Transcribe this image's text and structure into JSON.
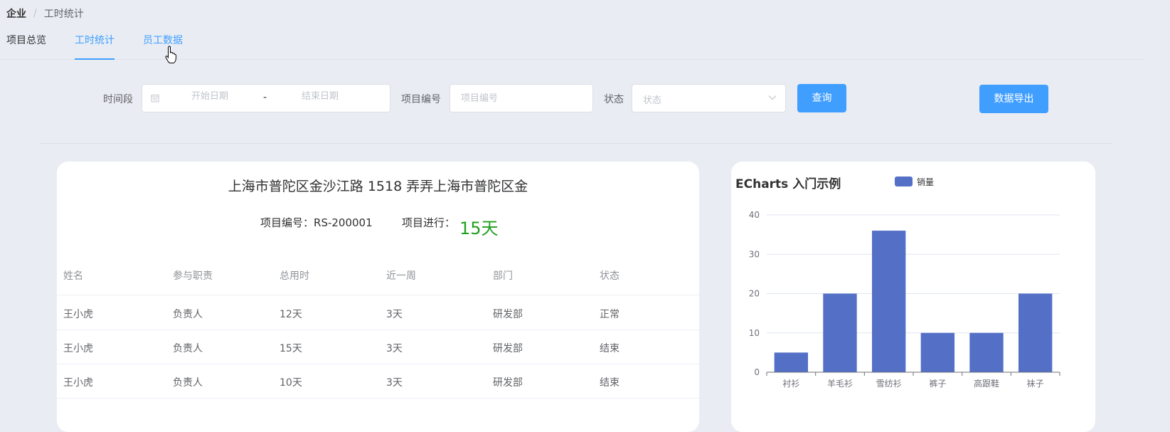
{
  "breadcrumb": {
    "root": "企业",
    "separator": "/",
    "current": "工时统计"
  },
  "tabs": [
    {
      "label": "项目总览"
    },
    {
      "label": "工时统计"
    },
    {
      "label": "员工数据"
    }
  ],
  "filters": {
    "time_label": "时间段",
    "start_placeholder": "开始日期",
    "range_separator": "-",
    "end_placeholder": "结束日期",
    "project_label": "项目编号",
    "project_placeholder": "项目编号",
    "status_label": "状态",
    "status_placeholder": "状态",
    "query_button": "查询",
    "export_button": "数据导出"
  },
  "colors": {
    "primary": "#409eff",
    "success": "#20a020",
    "bar": "#5470c6"
  },
  "project": {
    "address": "上海市普陀区金沙江路 1518 弄弄上海市普陀区金",
    "number_label": "项目编号：",
    "number_value": "RS-200001",
    "progress_label": "项目进行：",
    "progress_value": "15天"
  },
  "table": {
    "columns": [
      "姓名",
      "参与职责",
      "总用时",
      "近一周",
      "部门",
      "状态"
    ],
    "rows": [
      [
        "王小虎",
        "负责人",
        "12天",
        "3天",
        "研发部",
        "正常"
      ],
      [
        "王小虎",
        "负责人",
        "15天",
        "3天",
        "研发部",
        "结束"
      ],
      [
        "王小虎",
        "负责人",
        "10天",
        "3天",
        "研发部",
        "结束"
      ]
    ]
  },
  "chart_data": {
    "type": "bar",
    "title": "ECharts 入门示例",
    "categories": [
      "衬衫",
      "羊毛衫",
      "雪纺衫",
      "裤子",
      "高跟鞋",
      "袜子"
    ],
    "series": [
      {
        "name": "销量",
        "values": [
          5,
          20,
          36,
          10,
          10,
          20
        ]
      }
    ],
    "ylim": [
      0,
      40
    ],
    "yticks": [
      0,
      10,
      20,
      30,
      40
    ],
    "grid": true,
    "legend": "top"
  }
}
